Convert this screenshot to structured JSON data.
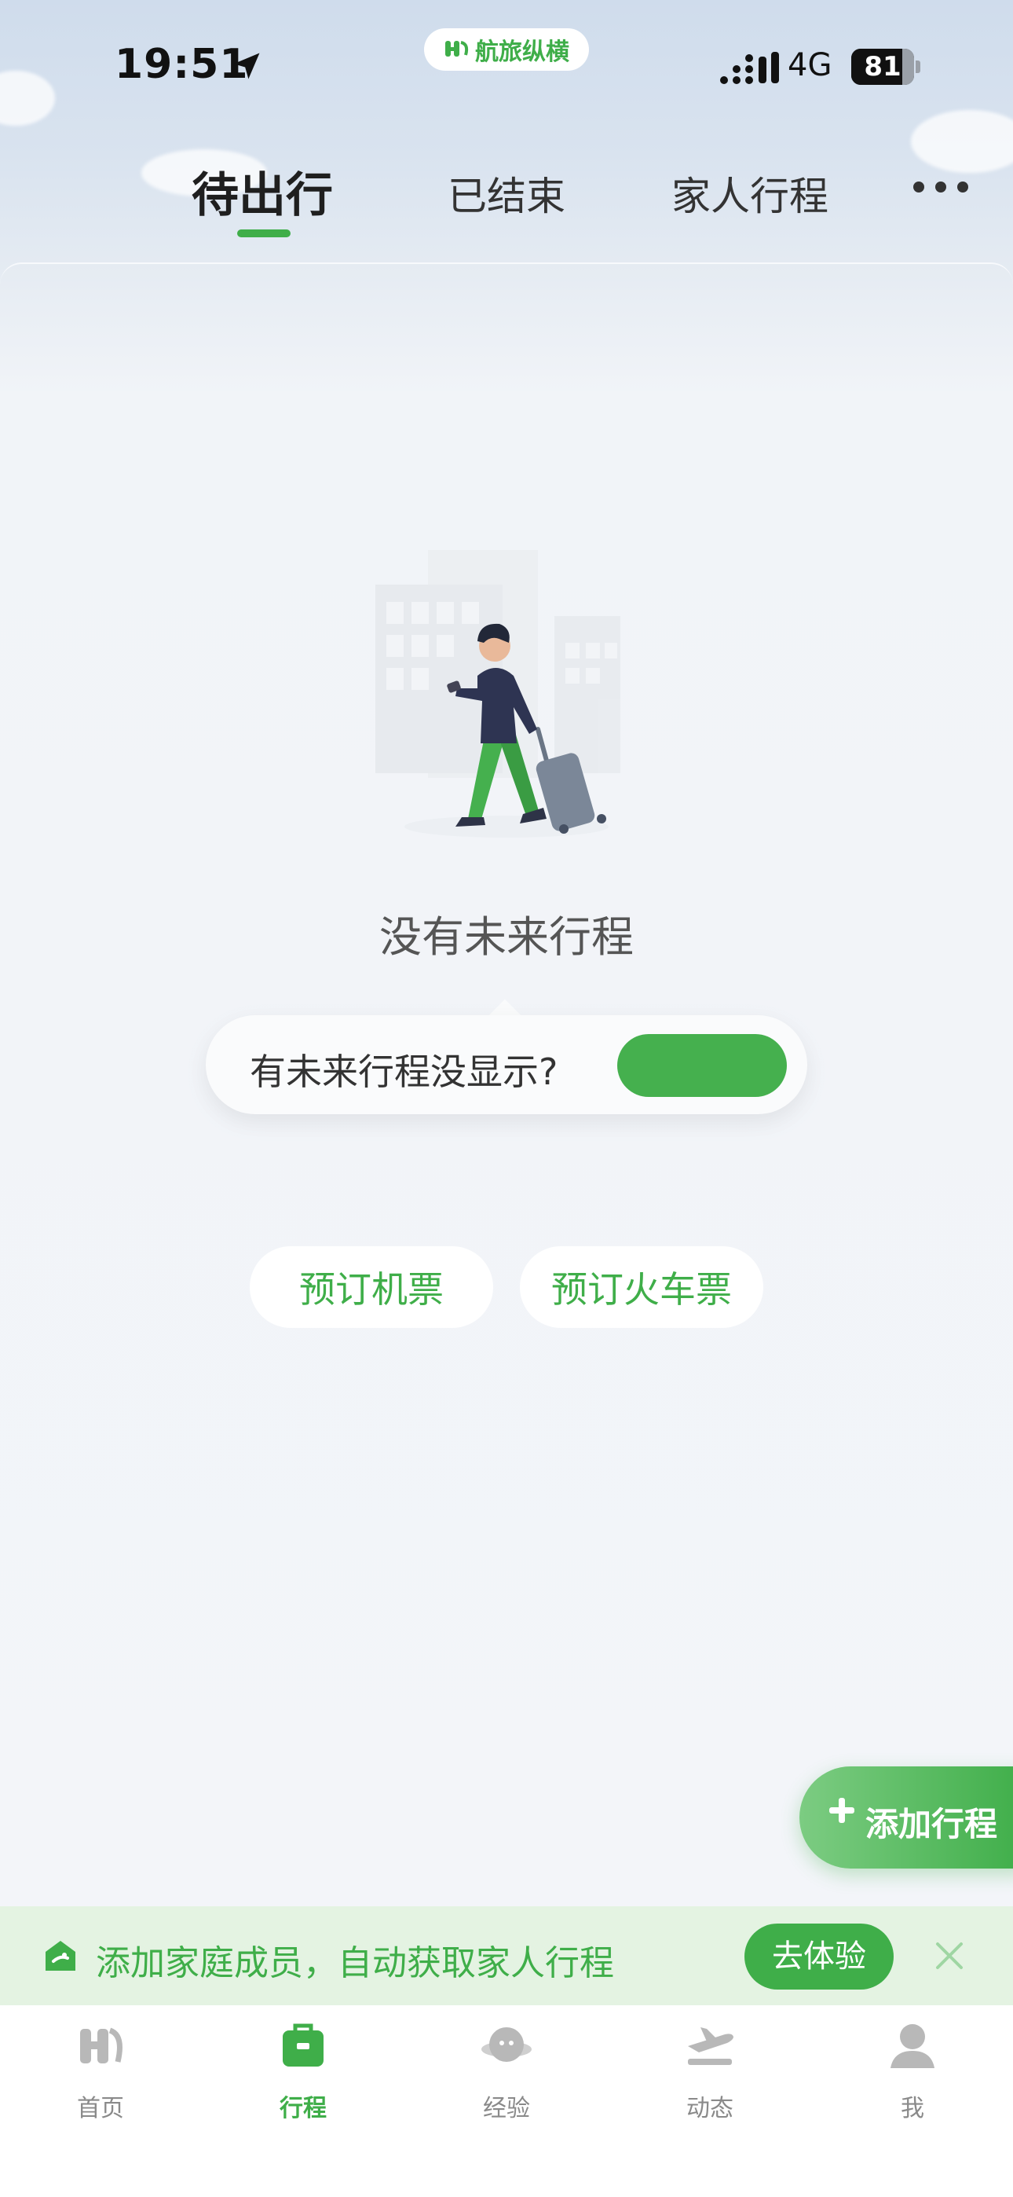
{
  "status_bar": {
    "time": "19:51",
    "network": "4G",
    "battery": "81",
    "battery_level": 0.81
  },
  "brand": {
    "name": "航旅纵横"
  },
  "tabs": [
    {
      "label": "待出行",
      "active": true
    },
    {
      "label": "已结束",
      "active": false
    },
    {
      "label": "家人行程",
      "active": false
    }
  ],
  "more_icon": "more-dots-icon",
  "empty_state": {
    "illustration": "traveler-with-suitcase",
    "message": "没有未来行程"
  },
  "tooltip": {
    "text": "有未来行程没显示?",
    "button_label": ""
  },
  "actions": {
    "book_flight": "预订机票",
    "book_train": "预订火车票",
    "add_trip": "添加行程"
  },
  "banner": {
    "text": "添加家庭成员，自动获取家人行程",
    "button": "去体验",
    "icon": "family-home-icon",
    "close_icon": "close-icon"
  },
  "bottom_nav": [
    {
      "label": "首页",
      "icon": "home-logo-icon",
      "active": false
    },
    {
      "label": "行程",
      "icon": "suitcase-icon",
      "active": true
    },
    {
      "label": "经验",
      "icon": "planet-icon",
      "active": false
    },
    {
      "label": "动态",
      "icon": "plane-landing-icon",
      "active": false
    },
    {
      "label": "我",
      "icon": "person-icon",
      "active": false
    }
  ],
  "colors": {
    "accent": "#3fae49",
    "header_bg": "#d3dfed",
    "page_bg": "#f1f4f8",
    "banner_bg": "#e4f3e2"
  }
}
